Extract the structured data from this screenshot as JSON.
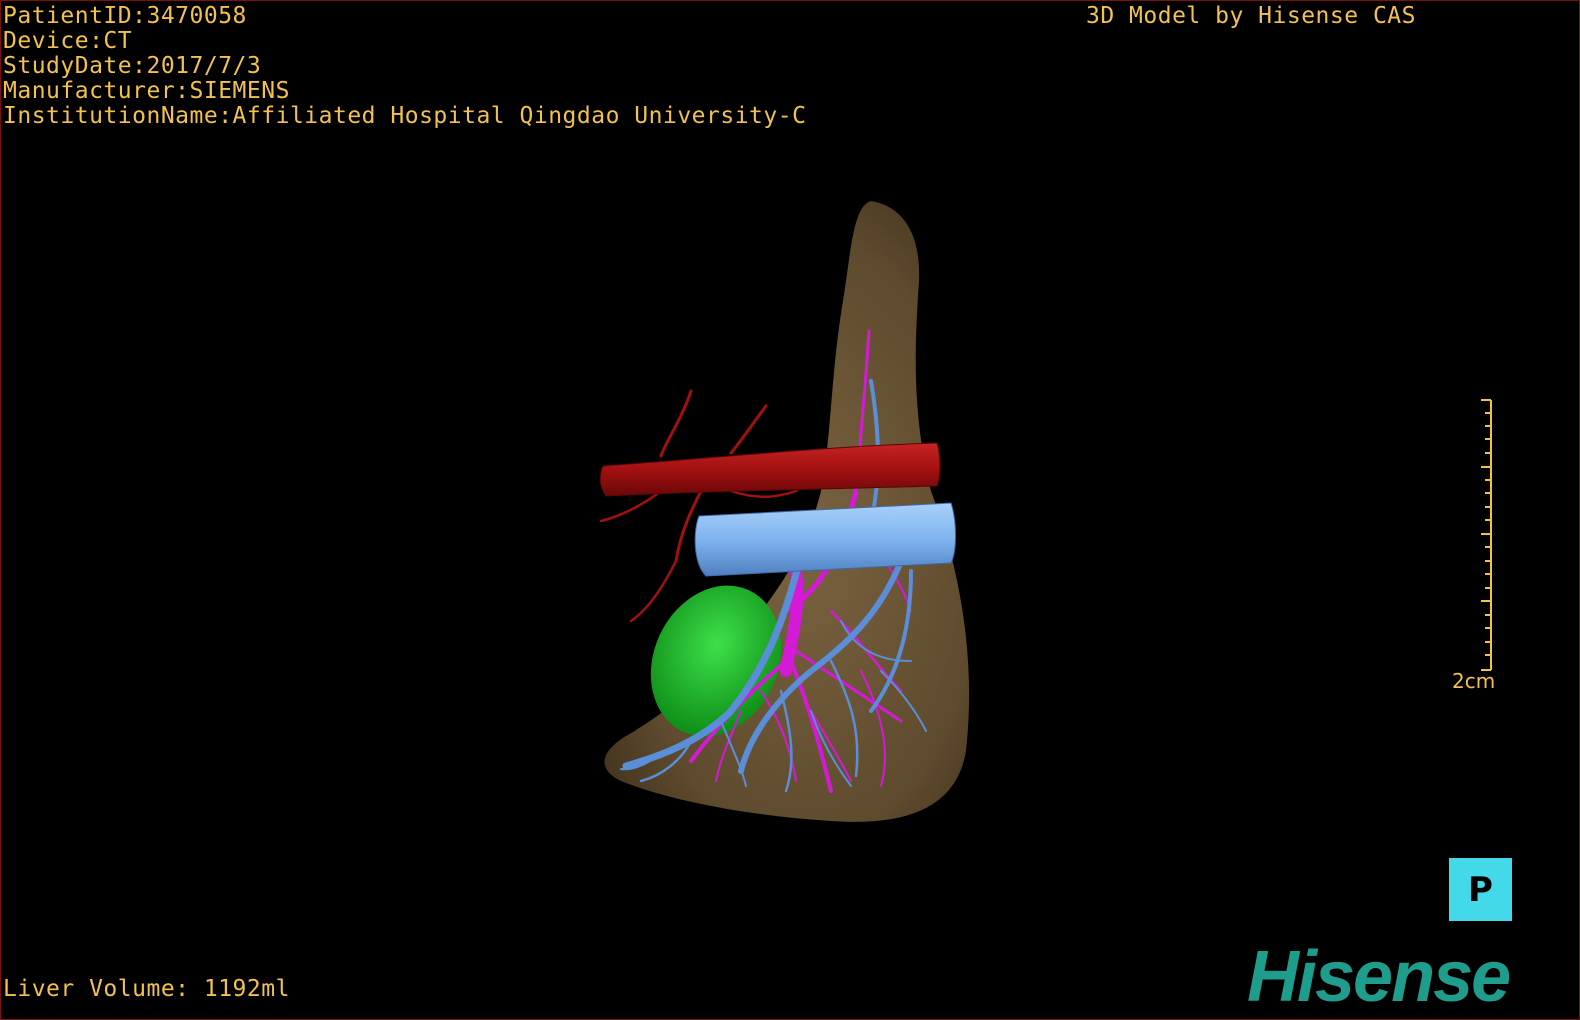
{
  "overlay": {
    "patient_id": "PatientID:3470058",
    "device": "Device:CT",
    "study_date": "StudyDate:2017/7/3",
    "manufacturer": "Manufacturer:SIEMENS",
    "institution": "InstitutionName:Affiliated Hospital Qingdao University-C",
    "credit": "3D Model by Hisense CAS",
    "liver_volume": "Liver Volume: 1192ml"
  },
  "scale": {
    "label": "2cm"
  },
  "orientation": {
    "label": "P"
  },
  "brand": {
    "logo_text": "Hisense",
    "color": "#1e9c8c"
  },
  "colors": {
    "overlay_text": "#f2c14e",
    "liver": "#6b5535",
    "artery": "#b31414",
    "vena_cava": "#7fb4f0",
    "portal_vein": "#d41ad6",
    "hepatic_vein": "#5b8ed8",
    "gallbladder": "#22c22e",
    "orientation_badge": "#43d9e8"
  }
}
